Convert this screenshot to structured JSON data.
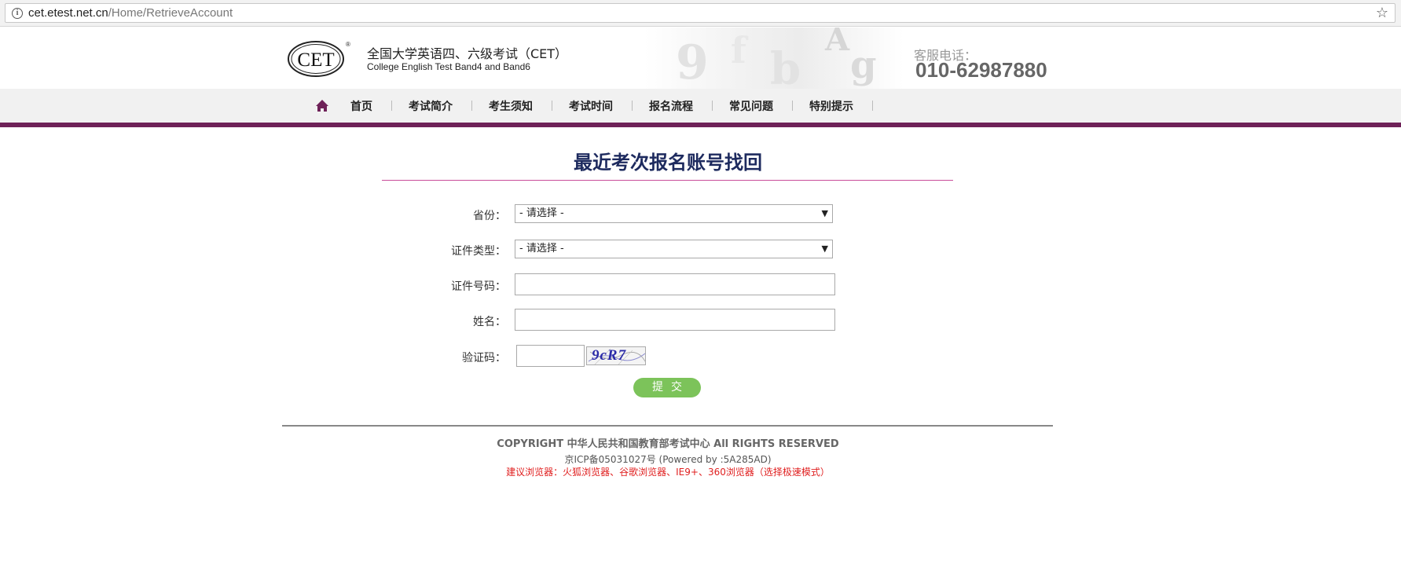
{
  "browser": {
    "url_host": "cet.etest.net.cn",
    "url_path": "/Home/RetrieveAccount",
    "info_icon": "info-icon",
    "bookmark_icon": "star-icon"
  },
  "header": {
    "logo_text": "CET",
    "logo_mark": "®",
    "title_cn": "全国大学英语四、六级考试（CET）",
    "title_en": "College English Test Band4 and Band6",
    "hotline_label": "客服电话：",
    "hotline_number": "010-62987880"
  },
  "nav": {
    "home_icon": "home-icon",
    "items": [
      {
        "label": "首页"
      },
      {
        "label": "考试简介"
      },
      {
        "label": "考生须知"
      },
      {
        "label": "考试时间"
      },
      {
        "label": "报名流程"
      },
      {
        "label": "常见问题"
      },
      {
        "label": "特别提示"
      }
    ]
  },
  "main": {
    "title": "最近考次报名账号找回",
    "form": {
      "province_label": "省份：",
      "province_value": "- 请选择 -",
      "id_type_label": "证件类型：",
      "id_type_value": "- 请选择 -",
      "id_number_label": "证件号码：",
      "id_number_value": "",
      "name_label": "姓名：",
      "name_value": "",
      "captcha_label": "验证码：",
      "captcha_value": "",
      "captcha_image_text": "9cR7",
      "submit_label": "提交"
    }
  },
  "footer": {
    "copyright": "COPYRIGHT 中华人民共和国教育部考试中心 All RIGHTS RESERVED",
    "icp": "京ICP备05031027号 (Powered by :5A285AD)",
    "browser_tip": "建议浏览器：火狐浏览器、谷歌浏览器、IE9+、360浏览器（选择极速模式）"
  },
  "colors": {
    "nav_accent": "#6e2158",
    "title_color": "#1d2a5e",
    "title_rule": "#c94c9a",
    "submit_button": "#7cc35a",
    "tip_red": "#e02020"
  }
}
